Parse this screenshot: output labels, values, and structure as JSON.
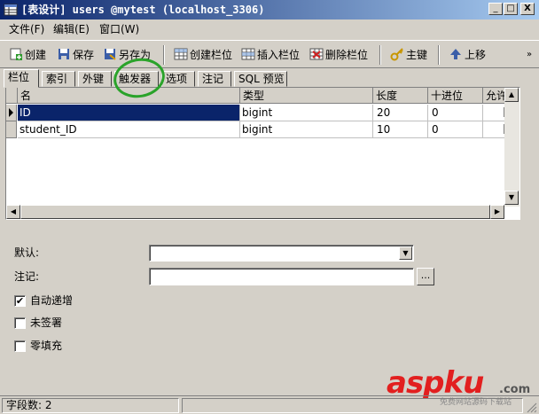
{
  "window": {
    "title": "[表设计] users @mytest (localhost_3306)",
    "controls": [
      "_",
      "□",
      "X"
    ]
  },
  "menu": [
    "文件(F)",
    "编辑(E)",
    "窗口(W)"
  ],
  "toolbar": {
    "create": "创建",
    "save": "保存",
    "save_as": "另存为",
    "create_column": "创建栏位",
    "insert_column": "插入栏位",
    "delete_column": "删除栏位",
    "primary_key": "主键",
    "move_up": "上移"
  },
  "tabs": [
    "栏位",
    "索引",
    "外键",
    "触发器",
    "选项",
    "注记",
    "SQL 预览"
  ],
  "active_tab": 0,
  "grid": {
    "columns": [
      "名",
      "类型",
      "长度",
      "十进位",
      "允许空"
    ],
    "rows": [
      {
        "name": "ID",
        "type": "bigint",
        "length": "20",
        "decimals": "0",
        "nullable": false,
        "selected": true
      },
      {
        "name": "student_ID",
        "type": "bigint",
        "length": "10",
        "decimals": "0",
        "nullable": false,
        "selected": false
      }
    ]
  },
  "properties": {
    "default_label": "默认:",
    "comment_label": "注记:",
    "browse_button": "...",
    "auto_increment_label": "自动递增",
    "auto_increment": true,
    "unsigned_label": "未签署",
    "unsigned": false,
    "zerofill_label": "零填充",
    "zerofill": false
  },
  "status": {
    "field_count": "字段数: 2"
  },
  "watermark": {
    "brand": "aspku",
    "domain": ".com",
    "tagline": "免费网站源码下载站"
  },
  "colors": {
    "titlebar_start": "#0a246a",
    "titlebar_end": "#a6caf0",
    "face": "#d4d0c8",
    "selection": "#0a246a",
    "annotation": "#2aa32a",
    "watermark": "#e21f1f"
  }
}
